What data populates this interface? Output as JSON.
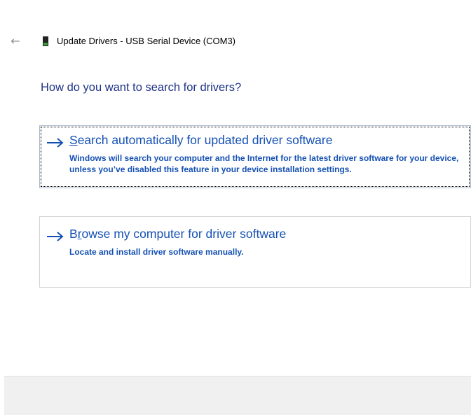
{
  "window": {
    "title": "Update Drivers - USB Serial Device (COM3)",
    "back_icon": "back-arrow-icon",
    "device_icon": "usb-device-icon"
  },
  "main": {
    "heading": "How do you want to search for drivers?",
    "options": [
      {
        "mnemonic": "S",
        "title_rest": "earch automatically for updated driver software",
        "description": "Windows will search your computer and the Internet for the latest driver software for your device, unless you’ve disabled this feature in your device installation settings.",
        "icon": "right-arrow-icon",
        "focused": true
      },
      {
        "title_pre": "B",
        "mnemonic": "r",
        "title_rest": "owse my computer for driver software",
        "description": "Locate and install driver software manually.",
        "icon": "right-arrow-icon",
        "focused": false
      }
    ]
  },
  "colors": {
    "link_blue": "#1450b4",
    "heading_blue": "#1e3287",
    "footer_bg": "#f0f0f0"
  }
}
